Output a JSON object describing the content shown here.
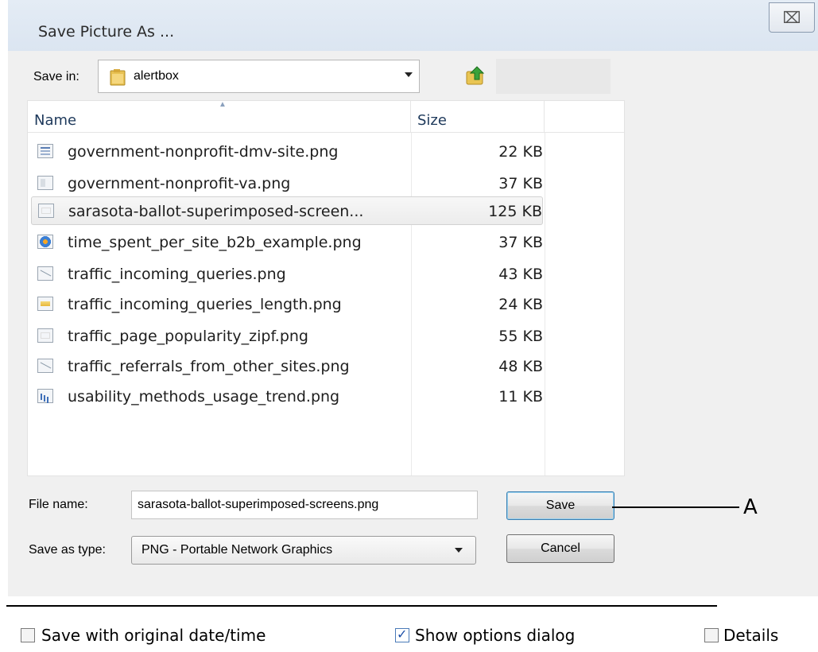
{
  "window": {
    "title": "Save Picture As ...",
    "close_glyph": "⌧"
  },
  "save_in": {
    "label": "Save in:",
    "value": "alertbox"
  },
  "file_list": {
    "columns": {
      "name": "Name",
      "size": "Size"
    },
    "files": [
      {
        "name": "government-nonprofit-dmv-site.png",
        "size": "22 KB",
        "icon": "lines"
      },
      {
        "name": "government-nonprofit-va.png",
        "size": "37 KB",
        "icon": "doc"
      },
      {
        "name": "sarasota-ballot-superimposed-screen...",
        "size": "125 KB",
        "icon": "blank",
        "selected": true
      },
      {
        "name": "time_spent_per_site_b2b_example.png",
        "size": "37 KB",
        "icon": "pie"
      },
      {
        "name": "traffic_incoming_queries.png",
        "size": "43 KB",
        "icon": "diag"
      },
      {
        "name": "traffic_incoming_queries_length.png",
        "size": "24 KB",
        "icon": "bars"
      },
      {
        "name": "traffic_page_popularity_zipf.png",
        "size": "55 KB",
        "icon": "blank"
      },
      {
        "name": "traffic_referrals_from_other_sites.png",
        "size": "48 KB",
        "icon": "diag"
      },
      {
        "name": "usability_methods_usage_trend.png",
        "size": "11 KB",
        "icon": "chart"
      }
    ]
  },
  "form": {
    "file_name_label": "File name:",
    "file_name_value": "sarasota-ballot-superimposed-screens.png",
    "type_label": "Save as type:",
    "type_value": "PNG - Portable Network Graphics"
  },
  "buttons": {
    "save": "Save",
    "cancel": "Cancel"
  },
  "callout": {
    "label": "A"
  },
  "options": {
    "save_date": {
      "label": "Save with original date/time",
      "checked": false
    },
    "show_options": {
      "label": "Show options dialog",
      "checked": true
    },
    "details": {
      "label": "Details",
      "checked": false
    }
  }
}
